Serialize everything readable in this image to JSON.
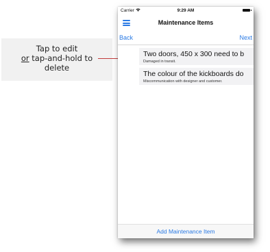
{
  "callout": {
    "line1": "Tap to edit",
    "line2_prefix": "or",
    "line2_rest": " tap-and-hold to",
    "line3": "delete"
  },
  "statusbar": {
    "carrier": "Carrier",
    "wifi_icon": "wifi-icon",
    "time": "9:29 AM",
    "battery_icon": "battery-icon"
  },
  "navbar": {
    "menu_icon": "hamburger-menu-icon",
    "title": "Maintenance Items"
  },
  "toolbar": {
    "back_label": "Back",
    "next_label": "Next"
  },
  "items": [
    {
      "title": "Two doors, 450 x 300 need to b",
      "subtitle": "Damaged in transit."
    },
    {
      "title": "The colour of the kickboards do",
      "subtitle": "Miscommunication with designer and customer."
    }
  ],
  "footer": {
    "add_label": "Add Maintenance Item"
  },
  "colors": {
    "accent": "#2a7ae4",
    "connector": "#c23b3b",
    "callout_bg": "#f1f1f1",
    "item_bg": "#f2f2f4"
  }
}
